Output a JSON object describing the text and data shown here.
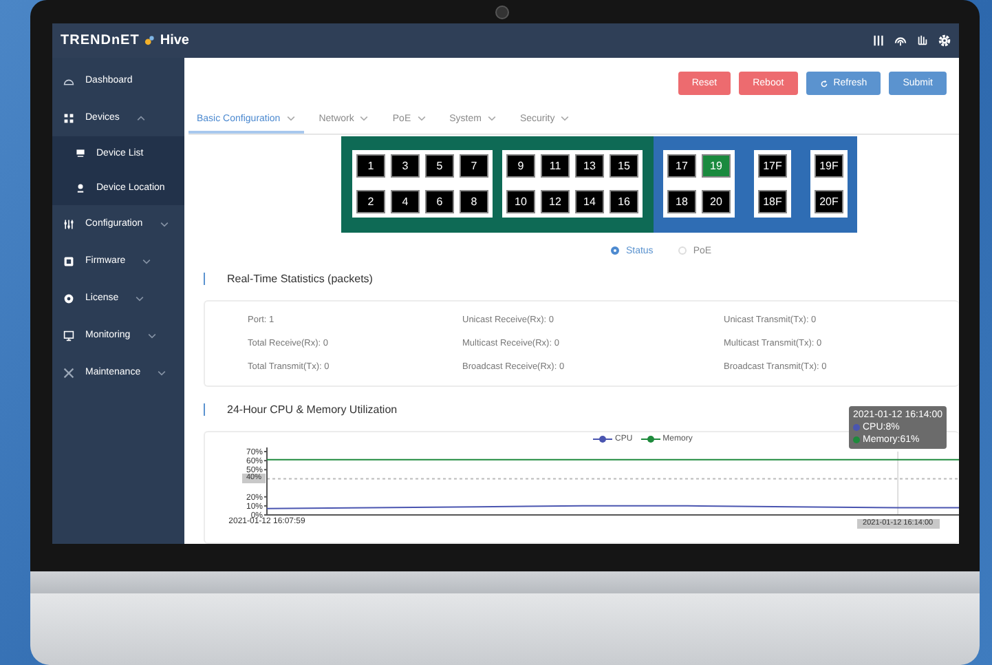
{
  "header": {
    "logo": "TRENDnET",
    "product": "Hive"
  },
  "sidebar": {
    "items": [
      {
        "label": "Dashboard",
        "selected": false
      },
      {
        "label": "Devices",
        "expanded": true,
        "selected": false,
        "children": [
          {
            "label": "Device List",
            "selected": false
          },
          {
            "label": "Device Location",
            "selected": false
          }
        ]
      },
      {
        "label": "Configuration",
        "expanded": false,
        "selected": false
      },
      {
        "label": "Firmware",
        "expanded": false,
        "selected": false
      },
      {
        "label": "License",
        "expanded": false,
        "selected": false
      },
      {
        "label": "Monitoring",
        "expanded": false,
        "selected": false
      },
      {
        "label": "Maintenance",
        "expanded": false,
        "selected": false
      }
    ]
  },
  "toolbar": {
    "buttons": [
      {
        "label": "Reset",
        "kind": "danger"
      },
      {
        "label": "Reboot",
        "kind": "danger"
      },
      {
        "label": "Refresh",
        "kind": "refresh"
      },
      {
        "label": "Submit",
        "kind": "primary"
      }
    ]
  },
  "tabs": [
    {
      "label": "Basic Configuration",
      "selected": true
    },
    {
      "label": "Network",
      "selected": false
    },
    {
      "label": "PoE",
      "selected": false
    },
    {
      "label": "System",
      "selected": false
    },
    {
      "label": "Security",
      "selected": false
    }
  ],
  "port_panel": {
    "groups": [
      {
        "kind": "copper",
        "panels": [
          [
            [
              {
                "label": "1",
                "active": false
              },
              {
                "label": "3",
                "active": false
              },
              {
                "label": "5",
                "active": false
              },
              {
                "label": "7",
                "active": false
              }
            ],
            [
              {
                "label": "2",
                "active": false
              },
              {
                "label": "4",
                "active": false
              },
              {
                "label": "6",
                "active": false
              },
              {
                "label": "8",
                "active": false
              }
            ]
          ],
          [
            [
              {
                "label": "9",
                "active": false
              },
              {
                "label": "11",
                "active": false
              },
              {
                "label": "13",
                "active": false
              },
              {
                "label": "15",
                "active": false
              }
            ],
            [
              {
                "label": "10",
                "active": false
              },
              {
                "label": "12",
                "active": false
              },
              {
                "label": "14",
                "active": false
              },
              {
                "label": "16",
                "active": false
              }
            ]
          ]
        ]
      },
      {
        "kind": "fiber",
        "panels": [
          [
            [
              {
                "label": "17",
                "active": false
              },
              {
                "label": "19",
                "active": true
              }
            ],
            [
              {
                "label": "18",
                "active": false
              },
              {
                "label": "20",
                "active": false
              }
            ]
          ],
          [
            [
              {
                "label": "17F",
                "active": false
              }
            ],
            [
              {
                "label": "18F",
                "active": false
              }
            ]
          ],
          [
            [
              {
                "label": "19F",
                "active": false
              }
            ],
            [
              {
                "label": "20F",
                "active": false
              }
            ]
          ]
        ]
      }
    ]
  },
  "view_options": [
    {
      "label": "Status",
      "selected": true
    },
    {
      "label": "PoE",
      "selected": false
    }
  ],
  "realtime_statistics": {
    "title": "Real-Time Statistics (packets)",
    "rows": [
      [
        "Port: 1",
        "Unicast Receive(Rx): 0",
        "Unicast Transmit(Tx): 0"
      ],
      [
        "Total Receive(Rx): 0",
        "Multicast Receive(Rx): 0",
        "Multicast Transmit(Tx): 0"
      ],
      [
        "Total Transmit(Tx): 0",
        "Broadcast Receive(Rx): 0",
        "Broadcast Transmit(Tx): 0"
      ]
    ]
  },
  "utilization": {
    "title": "24-Hour CPU & Memory Utilization",
    "chart_data": {
      "type": "line",
      "x": [
        "2021-01-12 16:07:59",
        null,
        null,
        null,
        null,
        null,
        "2021-01-12 16:14:00",
        null
      ],
      "legend": true,
      "series": [
        {
          "name": "CPU",
          "color": "#4a55b0",
          "values": [
            7,
            8,
            9,
            10,
            10,
            9,
            8,
            8
          ]
        },
        {
          "name": "Memory",
          "color": "#1e8a3c",
          "values": [
            61,
            61,
            61,
            61,
            61,
            61,
            61,
            61
          ]
        }
      ],
      "ylim": [
        0,
        70
      ],
      "yticks": [
        {
          "value": 0,
          "label": "0%"
        },
        {
          "value": 10,
          "label": "10%"
        },
        {
          "value": 20,
          "label": "20%"
        },
        {
          "value": 50,
          "label": "50%"
        },
        {
          "value": 60,
          "label": "60%"
        },
        {
          "value": 70,
          "label": "70%"
        }
      ],
      "ref_lines": [
        {
          "axis": "y",
          "value": 40,
          "label": "40%"
        },
        {
          "axis": "x",
          "value": "2021-01-12 16:14:00"
        }
      ]
    },
    "tooltip": {
      "title": "2021-01-12 16:14:00",
      "lines": [
        "CPU:8%",
        "Memory:61%"
      ]
    }
  }
}
